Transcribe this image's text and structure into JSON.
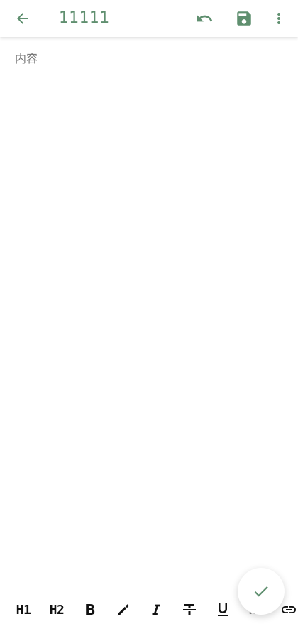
{
  "header": {
    "title": "11111",
    "icons": {
      "back": "arrow-left-icon",
      "undo": "undo-icon",
      "save": "save-icon",
      "more": "more-vertical-icon"
    },
    "accent_color": "#5f8f6f"
  },
  "editor": {
    "content_placeholder": "内容"
  },
  "fab": {
    "icon": "check-icon"
  },
  "toolbar": {
    "items": [
      {
        "label": "H1"
      },
      {
        "label": "H2"
      },
      {
        "label": "B"
      },
      {
        "icon": "highlighter-icon"
      },
      {
        "icon": "italic-icon"
      },
      {
        "icon": "strikethrough-icon"
      },
      {
        "icon": "underline-icon"
      },
      {
        "label": "H3"
      },
      {
        "icon": "link-icon"
      }
    ]
  }
}
